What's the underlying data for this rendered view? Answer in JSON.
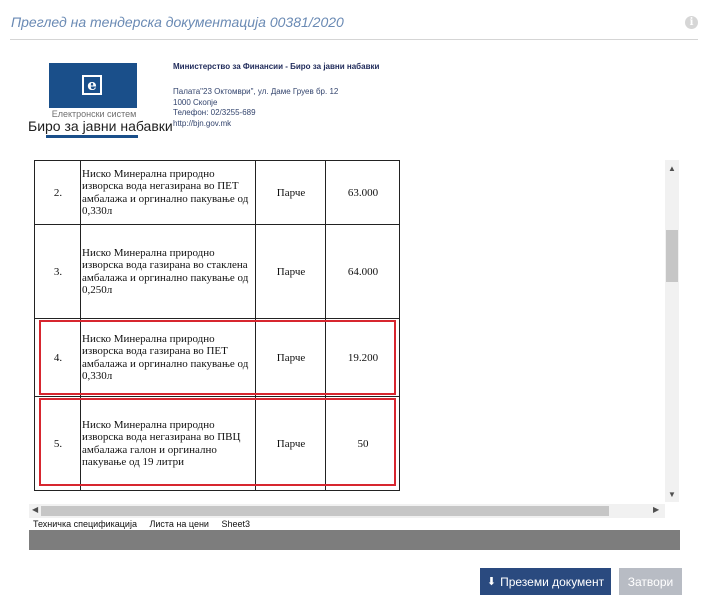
{
  "dialog": {
    "title": "Преглед на тендерска документација 00381/2020",
    "info_glyph": "i"
  },
  "letterhead": {
    "logo_letter": "e",
    "logo_subtitle": "Електронски систем",
    "logo_name": "Биро за јавни набавки",
    "org_name": "Министерство за Финансии - Биро за јавни набавки",
    "address": "Палата\"23 Октомври\", ул. Даме Груев бр. 12",
    "city": "1000 Скопје",
    "phone": "Телефон: 02/3255-689",
    "web": "http://bjn.gov.mk"
  },
  "table": {
    "rows": [
      {
        "num": "2.",
        "desc": "Ниско Минерална природно изворска вода  негазирана во ПЕТ амбалажа и оргинално пакување од 0,330л",
        "unit": "Парче",
        "qty": "63.000"
      },
      {
        "num": "3.",
        "desc": "Ниско Минерална природно изворска вода  газирана во стаклена амбалажа и оргинално пакување од 0,250л",
        "unit": "Парче",
        "qty": "64.000"
      },
      {
        "num": "4.",
        "desc": "Ниско Минерална природно изворска вода  газирана во ПЕТ амбалажа и оргинално пакување од 0,330л",
        "unit": "Парче",
        "qty": "19.200"
      },
      {
        "num": "5.",
        "desc": "Ниско Минерална природно изворска вода  негазирана во ПВЦ амбалажа галон и оргинално пакување од  19 литри",
        "unit": "Парче",
        "qty": "50"
      }
    ]
  },
  "sheets": [
    "Техничка спецификација",
    "Листа на цени",
    "Sheet3"
  ],
  "buttons": {
    "download": "Преземи документ",
    "close": "Затвори"
  },
  "colors": {
    "accent": "#2a4a7f",
    "highlight": "#d7262f",
    "title": "#6a8ab4"
  }
}
